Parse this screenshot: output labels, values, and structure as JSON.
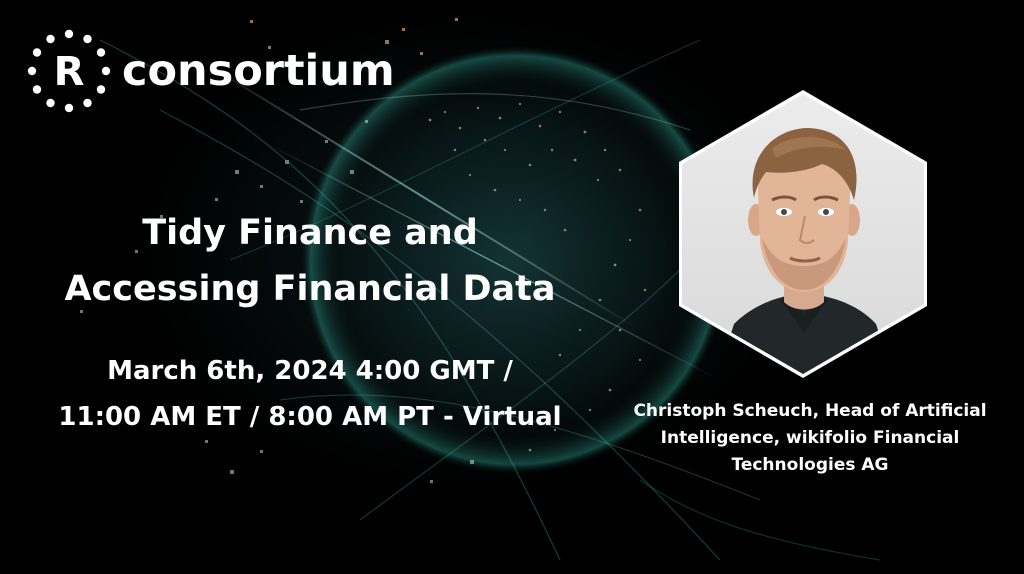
{
  "brand": {
    "logo_letter": "R",
    "name": "consortium"
  },
  "event": {
    "title_lines": [
      "Tidy Finance and",
      "Accessing Financial Data"
    ],
    "date_lines": [
      "March 6th, 2024 4:00 GMT /",
      "11:00 AM ET / 8:00 AM PT - Virtual"
    ]
  },
  "speaker": {
    "caption_lines": [
      "Christoph Scheuch, Head of Artificial",
      "Intelligence, wikifolio Financial",
      "Technologies AG"
    ]
  },
  "colors": {
    "background": "#000000",
    "text": "#ffffff",
    "accent_teal": "#2fb8a8",
    "accent_orange": "#e8a06a",
    "hexagon_frame": "#ffffff",
    "portrait_bg": "#e4e4e4"
  },
  "icons": {
    "logo": "r-consortium-logo-icon",
    "globe": "data-globe-icon"
  }
}
